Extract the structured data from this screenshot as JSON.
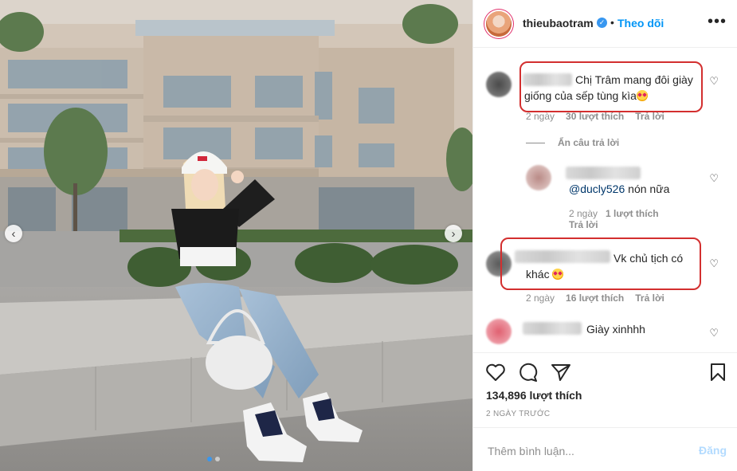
{
  "post": {
    "username": "thieubaotram",
    "follow_label": "Theo dõi",
    "more_label": "•••",
    "verified_icon": "verified-badge-icon",
    "likes": "134,896 lượt thích",
    "time_ago": "2 NGÀY TRƯỚC"
  },
  "comments": [
    {
      "text": "Chị Trâm mang đôi giày giống của sếp tùng kìa",
      "emoji": "star-struck-emoji",
      "age": "2 ngày",
      "likes": "30 lượt thích",
      "reply": "Trả lời"
    },
    {
      "hide_replies": "Ẩn câu trả lời"
    },
    {
      "mention": "@ducly526",
      "text": "nón nữa",
      "age": "2 ngày",
      "likes": "1 lượt thích",
      "reply": "Trả lời"
    },
    {
      "text": "Vk chủ tịch có khác",
      "emoji": "star-struck-emoji",
      "age": "2 ngày",
      "likes": "16 lượt thích",
      "reply": "Trả lời"
    },
    {
      "text": "Giày xinhhh"
    }
  ],
  "comment_input": {
    "placeholder": "Thêm bình luận...",
    "post_label": "Đăng"
  },
  "icons": {
    "like": "heart-icon",
    "comment": "comment-icon",
    "share": "paper-plane-icon",
    "save": "bookmark-icon"
  },
  "colors": {
    "link_blue": "#0095f6",
    "highlight_red": "#d32f2f",
    "muted": "#8e8e8e"
  }
}
